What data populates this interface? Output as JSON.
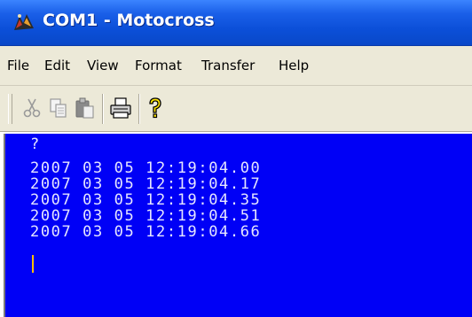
{
  "window": {
    "title": "COM1 - Motocross"
  },
  "menu": [
    {
      "label": "File"
    },
    {
      "label": "Edit"
    },
    {
      "label": "View"
    },
    {
      "label": "Format"
    },
    {
      "label": "Transfer"
    },
    {
      "label": "Help"
    }
  ],
  "toolbar": {
    "buttons": [
      "cut-icon",
      "copy-icon",
      "paste-icon",
      "print-icon",
      "help-icon"
    ]
  },
  "terminal": {
    "lines": [
      "?",
      "2007 03 05 12:19:04.00",
      "2007 03 05 12:19:04.17",
      "2007 03 05 12:19:04.35",
      "2007 03 05 12:19:04.51",
      "2007 03 05 12:19:04.66"
    ],
    "background": "#0000f6",
    "text_color": "#e6e6ff",
    "cursor_color": "#ffbf00"
  }
}
